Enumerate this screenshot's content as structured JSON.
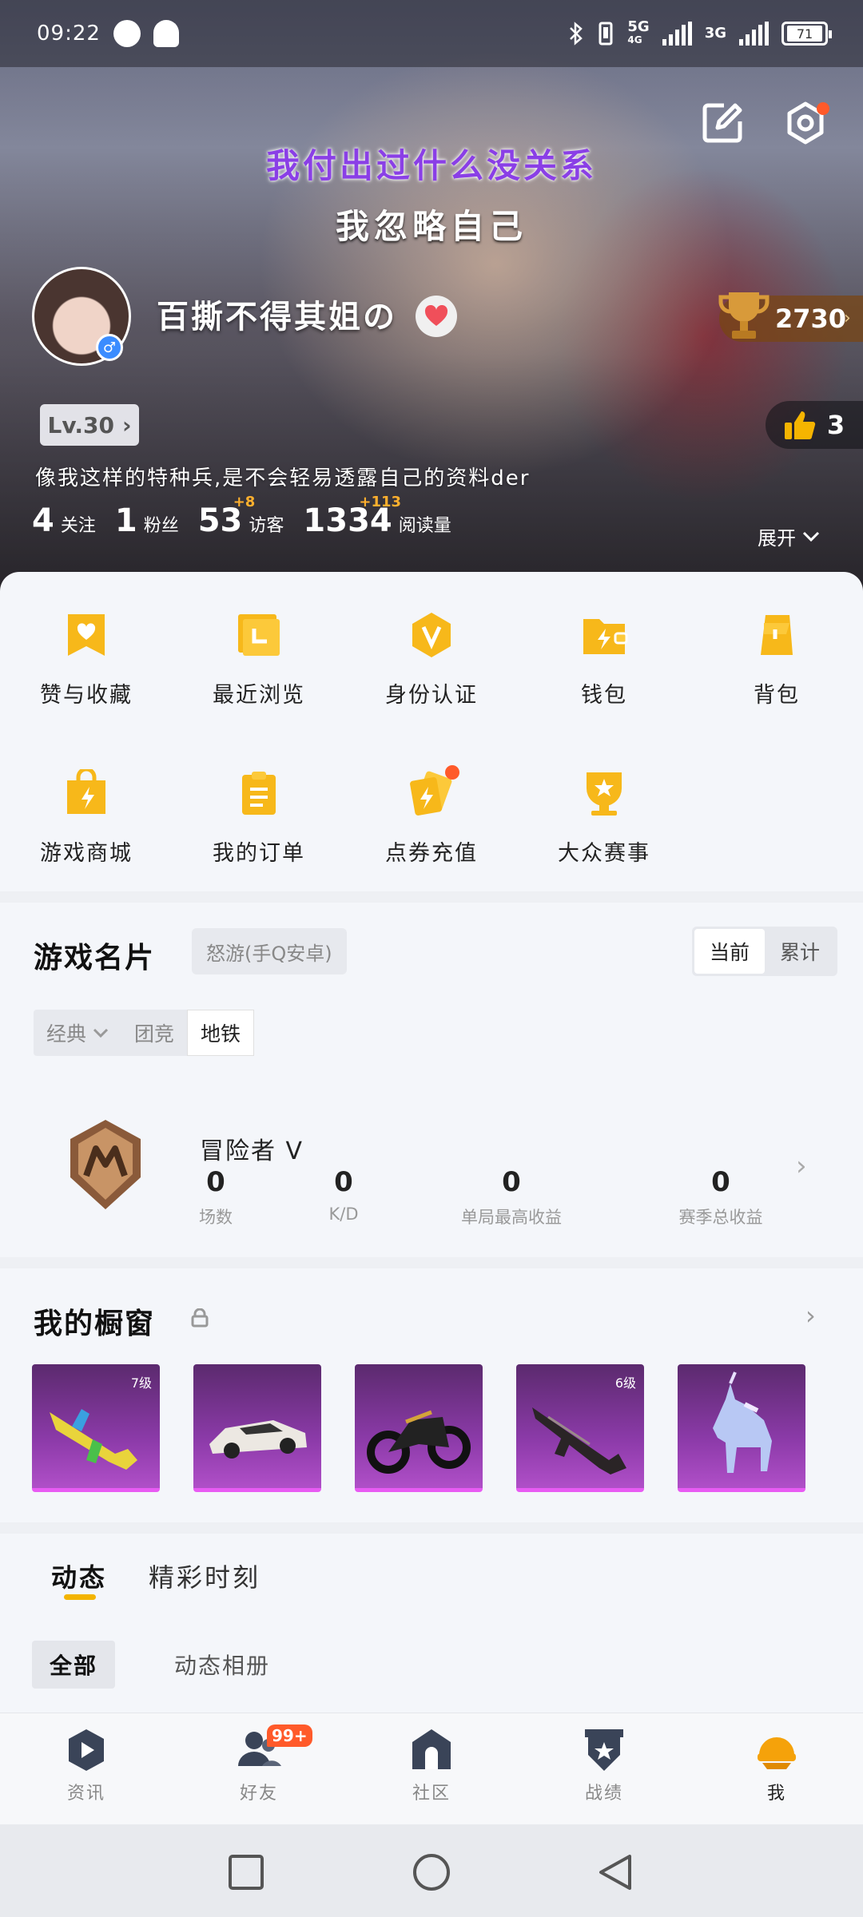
{
  "status_bar": {
    "time": "09:22",
    "net1": "5G",
    "net1_sub": "4G",
    "net2": "3G",
    "battery": "71"
  },
  "hero": {
    "quote_line1": "我付出过什么没关系",
    "quote_line2": "我忽略自己",
    "nickname": "百撕不得其姐の",
    "trophy_score": "2730",
    "level": "Lv.30",
    "likes": "3",
    "bio": "像我这样的特种兵,是不会轻易透露自己的资料der",
    "stats": [
      {
        "num": "4",
        "label": "关注",
        "plus": ""
      },
      {
        "num": "1",
        "label": "粉丝",
        "plus": ""
      },
      {
        "num": "53",
        "label": "访客",
        "plus": "+8"
      },
      {
        "num": "1334",
        "label": "阅读量",
        "plus": "+113"
      }
    ],
    "expand": "展开"
  },
  "menu": {
    "items": [
      {
        "label": "赞与收藏",
        "icon": "bookmark-heart-icon"
      },
      {
        "label": "最近浏览",
        "icon": "recent-folder-icon"
      },
      {
        "label": "身份认证",
        "icon": "verify-badge-icon"
      },
      {
        "label": "钱包",
        "icon": "wallet-icon"
      },
      {
        "label": "背包",
        "icon": "backpack-icon"
      },
      {
        "label": "游戏商城",
        "icon": "shop-bag-icon"
      },
      {
        "label": "我的订单",
        "icon": "order-list-icon"
      },
      {
        "label": "点券充值",
        "icon": "voucher-recharge-icon"
      },
      {
        "label": "大众赛事",
        "icon": "tournament-trophy-icon"
      }
    ]
  },
  "game_card": {
    "title": "游戏名片",
    "server_tag": "怒游(手Q安卓)",
    "toggle": [
      "当前",
      "累计"
    ],
    "modes": [
      "经典",
      "团竞",
      "地铁"
    ],
    "rank_name": "冒险者 V",
    "stats": [
      {
        "value": "0",
        "label": "场数"
      },
      {
        "value": "0",
        "label": "K/D"
      },
      {
        "value": "0",
        "label": "单局最高收益"
      },
      {
        "value": "0",
        "label": "赛季总收益"
      }
    ]
  },
  "showcase": {
    "title": "我的橱窗",
    "items": [
      {
        "name": "graffiti-rifle-skin",
        "level": "7级"
      },
      {
        "name": "white-sports-car-skin",
        "level": ""
      },
      {
        "name": "black-motorcycle-skin",
        "level": ""
      },
      {
        "name": "dark-rifle-skin",
        "level": "6级"
      },
      {
        "name": "crystal-unicorn-skin",
        "level": ""
      }
    ]
  },
  "feed": {
    "tabs": [
      "动态",
      "精彩时刻"
    ],
    "sub_tabs": [
      "全部",
      "动态相册"
    ]
  },
  "bottom_nav": {
    "items": [
      "资讯",
      "好友",
      "社区",
      "战绩",
      "我"
    ],
    "friends_badge": "99+"
  },
  "colors": {
    "accent_yellow": "#f3b400",
    "badge_red": "#ff5a2a",
    "skin_purple": "#8b3aa8"
  }
}
